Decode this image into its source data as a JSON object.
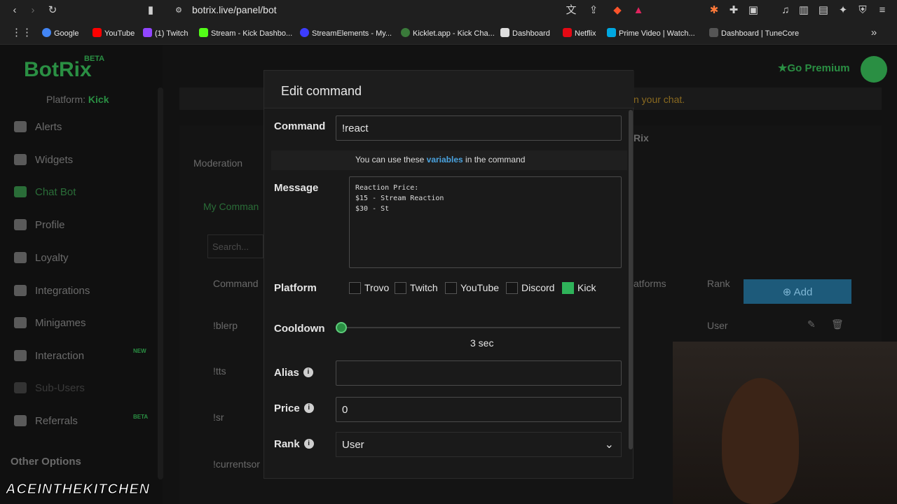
{
  "browser": {
    "url": "botrix.live/panel/bot",
    "bookmarks": [
      {
        "label": "Google",
        "color": "#4285f4"
      },
      {
        "label": "YouTube",
        "color": "#ff0000"
      },
      {
        "label": "(1) Twitch",
        "color": "#9146ff"
      },
      {
        "label": "Stream - Kick Dashbo...",
        "color": "#53fc18"
      },
      {
        "label": "StreamElements - My...",
        "color": "#3d3dff"
      },
      {
        "label": "Kicklet.app - Kick Cha...",
        "color": "#3a7a3a"
      },
      {
        "label": "Dashboard",
        "color": "#dddddd"
      },
      {
        "label": "Netflix",
        "color": "#e50914"
      },
      {
        "label": "Prime Video | Watch...",
        "color": "#00a8e1"
      },
      {
        "label": "Dashboard | TuneCore",
        "color": "#555555"
      }
    ]
  },
  "sidebar": {
    "logo": "BotRix",
    "beta": "BETA",
    "platform_label": "Platform:",
    "platform_value": "Kick",
    "items": [
      {
        "label": "Alerts"
      },
      {
        "label": "Widgets"
      },
      {
        "label": "Chat Bot"
      },
      {
        "label": "Profile"
      },
      {
        "label": "Loyalty"
      },
      {
        "label": "Integrations"
      },
      {
        "label": "Minigames"
      },
      {
        "label": "Interaction",
        "tag": "NEW"
      },
      {
        "label": "Sub-Users"
      },
      {
        "label": "Referrals",
        "tag": "BETA"
      }
    ],
    "other_options": "Other Options"
  },
  "header": {
    "premium": "Go Premium"
  },
  "background": {
    "notice_tail": "n your chat.",
    "rix_tail": "Rix",
    "tab_moderation": "Moderation",
    "my_commands": "My Comman",
    "search_placeholder": "Search...",
    "add_label": "Add",
    "col_command": "Command",
    "col_platforms": "atforms",
    "col_rank": "Rank",
    "rows": [
      {
        "command": "!blerp",
        "rank": "User"
      },
      {
        "command": "!tts",
        "rank": ""
      },
      {
        "command": "!sr",
        "rank": ""
      },
      {
        "command": "!currentsor",
        "rank": ""
      }
    ]
  },
  "modal": {
    "title": "Edit command",
    "command_label": "Command",
    "command_value": "!react",
    "hint_prefix": "You can use these",
    "hint_link": "variables",
    "hint_suffix": "in the command",
    "message_label": "Message",
    "message_value": "Reaction Price:\n$15 - Stream Reaction\n$30 - St",
    "platform_label": "Platform",
    "platforms": [
      {
        "label": "Trovo",
        "checked": false
      },
      {
        "label": "Twitch",
        "checked": false
      },
      {
        "label": "YouTube",
        "checked": false
      },
      {
        "label": "Discord",
        "checked": false
      },
      {
        "label": "Kick",
        "checked": true
      }
    ],
    "cooldown_label": "Cooldown",
    "cooldown_value": "3 sec",
    "alias_label": "Alias",
    "alias_value": "",
    "price_label": "Price",
    "price_value": "0",
    "rank_label": "Rank",
    "rank_value": "User"
  },
  "overlay": {
    "watermark": "ACEINTHEKITCHEN"
  }
}
